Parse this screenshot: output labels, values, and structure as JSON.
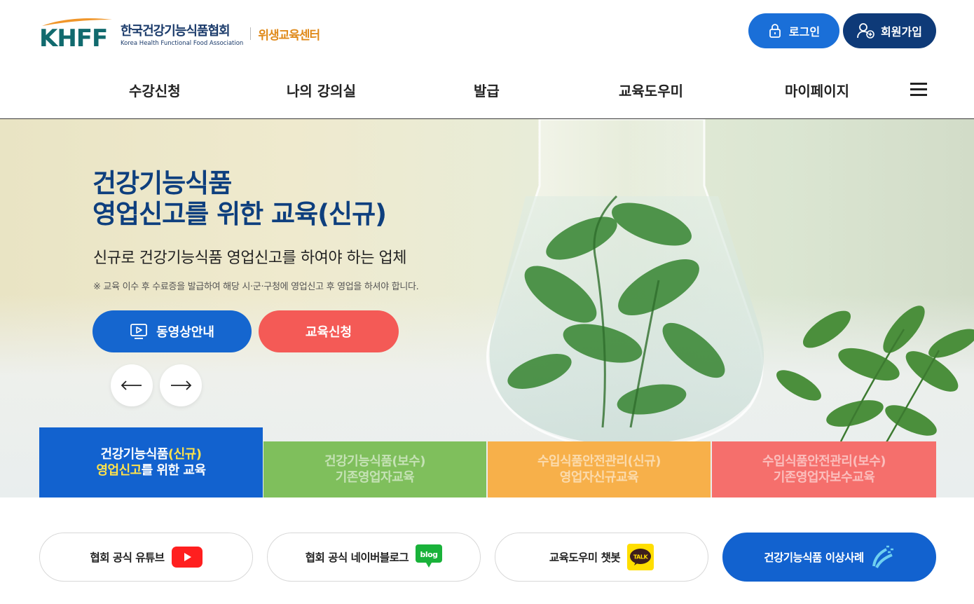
{
  "header": {
    "logo_abbr": "KHFF",
    "org_name": "한국건강기능식품협회",
    "org_name_en": "Korea Health Functional Food Association",
    "center_name": "위생교육센터",
    "login_label": "로그인",
    "join_label": "회원가입"
  },
  "nav": {
    "items": [
      {
        "label": "수강신청"
      },
      {
        "label": "나의 강의실"
      },
      {
        "label": "발급"
      },
      {
        "label": "교육도우미"
      },
      {
        "label": "마이페이지"
      }
    ]
  },
  "hero": {
    "title_line1": "건강기능식품",
    "title_line2": "영업신고를 위한 교육(신규)",
    "subtitle": "신규로 건강기능식품 영업신고를 하여야 하는 업체",
    "note": "※ 교육 이수 후 수료증을 발급하여 해당 시·군·구청에 영업신고 후 영업을 하셔야 합니다.",
    "video_button": "동영상안내",
    "apply_button": "교육신청"
  },
  "tabs": [
    {
      "line1_a": "건강기능식품",
      "line1_b": "(신규)",
      "line2_a": "영업신고",
      "line2_b": "를 위한 교육",
      "color": "#1262cf"
    },
    {
      "line1": "건강기능식품(보수)",
      "line2": "기존영업자교육",
      "color": "#7fbf5c"
    },
    {
      "line1": "수입식품안전관리(신규)",
      "line2": "영업자신규교육",
      "color": "#f7b04a"
    },
    {
      "line1": "수입식품안전관리(보수)",
      "line2": "기존영업자보수교육",
      "color": "#f56f6c"
    }
  ],
  "quick_links": [
    {
      "label": "협회 공식 유튜브",
      "icon": "youtube-icon"
    },
    {
      "label": "협회 공식 네이버블로그",
      "icon": "blog-icon",
      "badge": "blog"
    },
    {
      "label": "교육도우미 챗봇",
      "icon": "kakao-talk-icon",
      "badge": "TALK"
    },
    {
      "label": "건강기능식품 이상사례",
      "icon": "report-icon"
    }
  ],
  "colors": {
    "primary": "#1262cf",
    "navy": "#0e3a78",
    "accent_orange": "#e08a1a",
    "red": "#f45a56"
  }
}
